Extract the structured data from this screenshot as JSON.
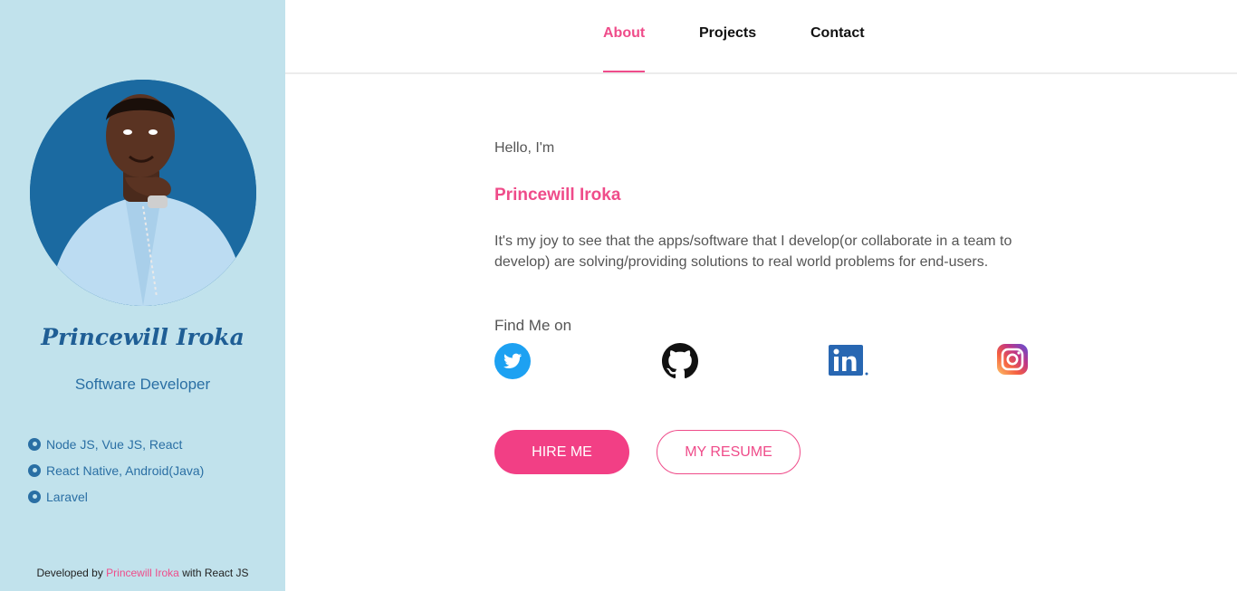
{
  "sidebar": {
    "name": "Princewill Iroka",
    "role": "Software Developer",
    "skills": [
      "Node JS, Vue JS, React",
      "React Native, Android(Java)",
      "Laravel"
    ],
    "credit": {
      "prefix": "Developed by ",
      "author": "Princewill Iroka",
      "suffix": " with React JS"
    }
  },
  "nav": {
    "items": [
      "About",
      "Projects",
      "Contact"
    ],
    "active": "About"
  },
  "main": {
    "greeting": "Hello, I'm",
    "name": "Princewill Iroka",
    "bio": "It's my joy to see that the apps/software that I develop(or collaborate in a team to develop) are solving/providing solutions to real world problems for end-users.",
    "find_me": "Find Me on",
    "social": [
      {
        "icon": "twitter-icon",
        "color": "#1da1f2"
      },
      {
        "icon": "github-icon",
        "color": "#111111"
      },
      {
        "icon": "linkedin-icon",
        "color": "#2867b2"
      },
      {
        "icon": "instagram-icon",
        "color": "#e1306c"
      }
    ],
    "buttons": {
      "hire": "HIRE ME",
      "resume": "MY RESUME"
    }
  },
  "colors": {
    "accent": "#ef4c8a",
    "sidebar_bg": "#c1e2ec",
    "sidebar_text": "#2a6fa4"
  }
}
